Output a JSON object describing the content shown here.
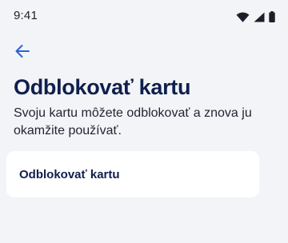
{
  "status_bar": {
    "time": "9:41",
    "icons": [
      "wifi-icon",
      "cellular-signal-icon",
      "battery-icon"
    ]
  },
  "header": {
    "back_icon": "arrow-left-icon"
  },
  "main": {
    "title": "Odblokovať kartu",
    "subtitle": "Svoju kartu môžete odblokovať a znova ju okamžite používať.",
    "action_label": "Odblokovať kartu"
  },
  "colors": {
    "background": "#f3f4f7",
    "title": "#0f1f4d",
    "accent": "#2a64d6",
    "card": "#ffffff"
  }
}
